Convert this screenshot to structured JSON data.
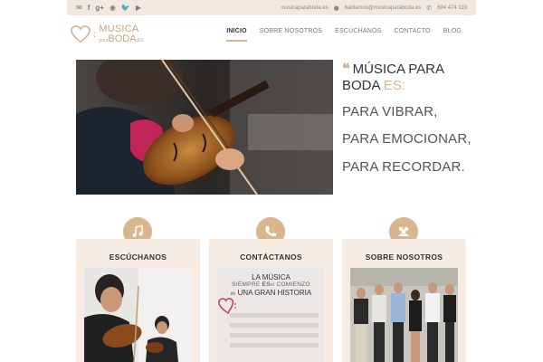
{
  "topbar": {
    "social_icons": [
      "email-icon",
      "facebook-icon",
      "google-plus-icon",
      "rss-icon",
      "twitter-icon",
      "youtube-icon"
    ],
    "site": "musicaparaboda.es",
    "email": "hablamos@musicaparaboda.es",
    "phone": "694 474 119"
  },
  "logo": {
    "line1": "MÚSICA",
    "line2": "BODA",
    "small_para": "para",
    "suffix": ".ES"
  },
  "nav": {
    "items": [
      {
        "label": "INICIO",
        "active": true
      },
      {
        "label": "SOBRE NOSOTROS",
        "active": false
      },
      {
        "label": "ESCÚCHANOS",
        "active": false
      },
      {
        "label": "CONTACTO",
        "active": false
      },
      {
        "label": "BLOG",
        "active": false
      }
    ]
  },
  "hero": {
    "title_part1": "MÚSICA PARA",
    "title_part2": "BODA",
    "title_accent": "ES:",
    "phrases": [
      "PARA VIBRAR,",
      "PARA EMOCIONAR,",
      "PARA RECORDAR."
    ]
  },
  "cards": [
    {
      "title": "ESCÚCHANOS",
      "icon": "music-note-icon"
    },
    {
      "title": "CONTÁCTANOS",
      "icon": "phone-icon"
    },
    {
      "title": "SOBRE NOSOTROS",
      "icon": "group-icon"
    }
  ],
  "contact_image": {
    "line1": "LA MÚSICA",
    "line2a": "SIEMPRE",
    "line2b": "ES",
    "line2c": "el",
    "line2d": "COMIENZO",
    "line3a": "de",
    "line3b": "UNA GRAN HISTORIA"
  },
  "colors": {
    "accent": "#d4b48c",
    "topbar_bg": "#f3e8df",
    "card_bg": "#f6ece3"
  }
}
